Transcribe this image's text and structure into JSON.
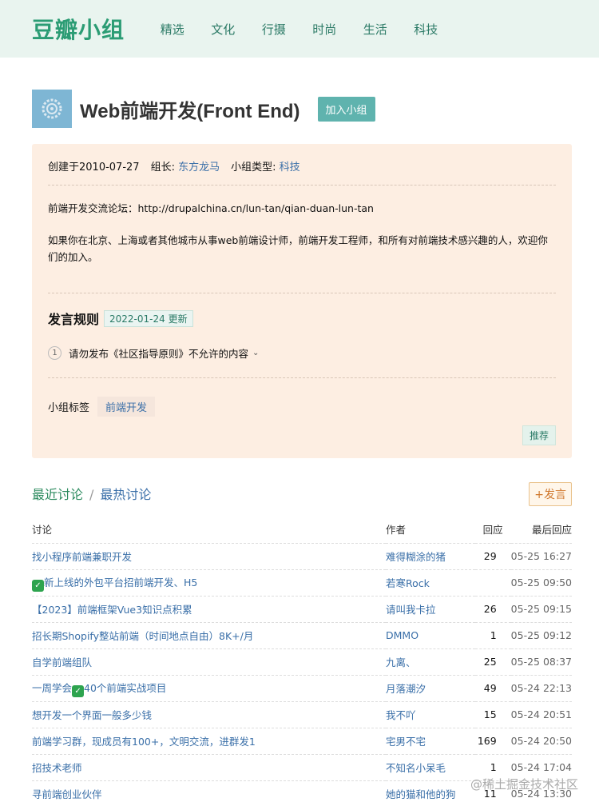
{
  "site": {
    "logo": "豆瓣小组",
    "nav": [
      "精选",
      "文化",
      "行摄",
      "时尚",
      "生活",
      "科技"
    ]
  },
  "group": {
    "title": "Web前端开发(Front End)",
    "join_label": "加入小组",
    "created": "创建于2010-07-27",
    "leader_label": "组长:",
    "leader": "东方龙马",
    "type_label": "小组类型:",
    "type": "科技",
    "forum": "前端开发交流论坛：http://drupalchina.cn/lun-tan/qian-duan-lun-tan",
    "description": "如果你在北京、上海或者其他城市从事web前端设计师，前端开发工程师，和所有对前端技术感兴趣的人，欢迎你们的加入。",
    "rules_title": "发言规则",
    "rules_date": "2022-01-24 更新",
    "rule_num": "1",
    "rule_text": "请勿发布《社区指导原则》不允许的内容",
    "tags_label": "小组标签",
    "tag": "前端开发",
    "recommend_label": "推荐"
  },
  "discussion": {
    "tab_recent": "最近讨论",
    "tab_sep": "/",
    "tab_hot": "最热讨论",
    "post_label": "+发言",
    "headers": [
      "讨论",
      "作者",
      "回应",
      "最后回应"
    ],
    "rows": [
      {
        "title": "找小程序前端兼职开发",
        "author": "难得糊涂的猪",
        "replies": "29",
        "last": "05-25 16:27"
      },
      {
        "title": "新上线的外包平台招前端开发、H5",
        "author": "若寒Rock",
        "replies": "",
        "last": "05-25 09:50",
        "check_prefix": "✓"
      },
      {
        "title": "【2023】前端框架Vue3知识点积累",
        "author": "请叫我卡拉",
        "replies": "26",
        "last": "05-25 09:15"
      },
      {
        "title": "招长期Shopify整站前端（时间地点自由）8K+/月",
        "author": "DMMO",
        "replies": "1",
        "last": "05-25 09:12"
      },
      {
        "title": "自学前端组队",
        "author": "九离、",
        "replies": "25",
        "last": "05-25 08:37"
      },
      {
        "title_a": "一周学会",
        "title_b": "40个前端实战项目",
        "check_mid": "✓",
        "author": "月落潮汐",
        "replies": "49",
        "last": "05-24 22:13"
      },
      {
        "title": "想开发一个界面一般多少钱",
        "author": "我不吖",
        "replies": "15",
        "last": "05-24 20:51"
      },
      {
        "title": "前端学习群，现成员有100+，文明交流，进群发1",
        "author": "宅男不宅",
        "replies": "169",
        "last": "05-24 20:50"
      },
      {
        "title": "招技术老师",
        "author": "不知名小呆毛",
        "replies": "1",
        "last": "05-24 17:04"
      },
      {
        "title": "寻前端创业伙伴",
        "author": "她的猫和他的狗",
        "replies": "11",
        "last": "05-24 13:30"
      }
    ]
  },
  "watermark": "@稀土掘金技术社区"
}
